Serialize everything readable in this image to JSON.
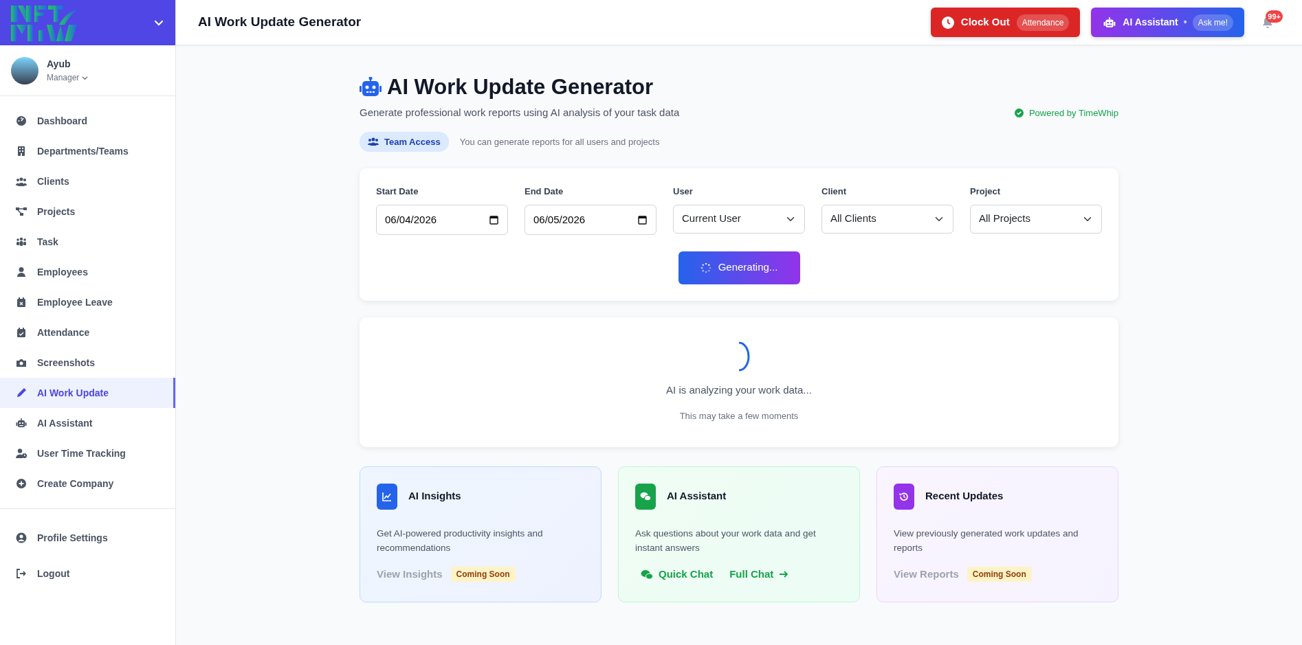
{
  "sidebar": {
    "user": {
      "name": "Ayub",
      "role": "Manager"
    },
    "nav": [
      {
        "label": "Dashboard",
        "selected": false
      },
      {
        "label": "Departments/Teams",
        "selected": false
      },
      {
        "label": "Clients",
        "selected": false
      },
      {
        "label": "Projects",
        "selected": false
      },
      {
        "label": "Task",
        "selected": false
      },
      {
        "label": "Employees",
        "selected": false
      },
      {
        "label": "Employee Leave",
        "selected": false
      },
      {
        "label": "Attendance",
        "selected": false
      },
      {
        "label": "Screenshots",
        "selected": false
      },
      {
        "label": "AI Work Update",
        "selected": true
      },
      {
        "label": "AI Assistant",
        "selected": false
      },
      {
        "label": "User Time Tracking",
        "selected": false
      },
      {
        "label": "Create Company",
        "selected": false
      }
    ],
    "footer": [
      {
        "label": "Profile Settings",
        "selected": false
      },
      {
        "label": "Logout",
        "selected": false
      }
    ]
  },
  "header": {
    "title": "AI Work Update Generator",
    "clock_out": {
      "label": "Clock Out",
      "badge": "Attendance"
    },
    "ai_assistant": {
      "label": "AI Assistant",
      "separator": "•",
      "badge": "Ask me!"
    },
    "notifications": {
      "badge": "99+"
    }
  },
  "page": {
    "title": "AI Work Update Generator",
    "subtitle": "Generate professional work reports using AI analysis of your task data",
    "powered_by": "Powered by TimeWhip",
    "access_badge": "Team Access",
    "access_note": "You can generate reports for all users and projects"
  },
  "form": {
    "fields": [
      {
        "label": "Start Date",
        "kind": "date",
        "value": "06/04/2026"
      },
      {
        "label": "End Date",
        "kind": "date",
        "value": "06/05/2026"
      },
      {
        "label": "User",
        "kind": "select",
        "value": "Current User"
      },
      {
        "label": "Client",
        "kind": "select",
        "value": "All Clients"
      },
      {
        "label": "Project",
        "kind": "select",
        "value": "All Projects"
      }
    ],
    "button": {
      "label": "Generating...",
      "loading": true
    }
  },
  "loading": {
    "message": "AI is analyzing your work data...",
    "note": "This may take a few moments"
  },
  "cards": [
    {
      "kind": "insights",
      "color": "#2563eb",
      "title": "AI Insights",
      "description": "Get AI-powered productivity insights and recommendations",
      "actions": [
        {
          "kind": "muted",
          "label": "View Insights"
        },
        {
          "kind": "badge",
          "label": "Coming Soon"
        }
      ]
    },
    {
      "kind": "chat",
      "color": "#16a34a",
      "title": "AI Assistant",
      "description": "Ask questions about your work data and get instant answers",
      "actions": [
        {
          "kind": "chat",
          "label": "Quick Chat"
        },
        {
          "kind": "arrow",
          "label": "Full Chat"
        }
      ]
    },
    {
      "kind": "reports",
      "color": "#9333ea",
      "title": "Recent Updates",
      "description": "View previously generated work updates and reports",
      "actions": [
        {
          "kind": "muted",
          "label": "View Reports"
        },
        {
          "kind": "badge",
          "label": "Coming Soon"
        }
      ]
    }
  ]
}
